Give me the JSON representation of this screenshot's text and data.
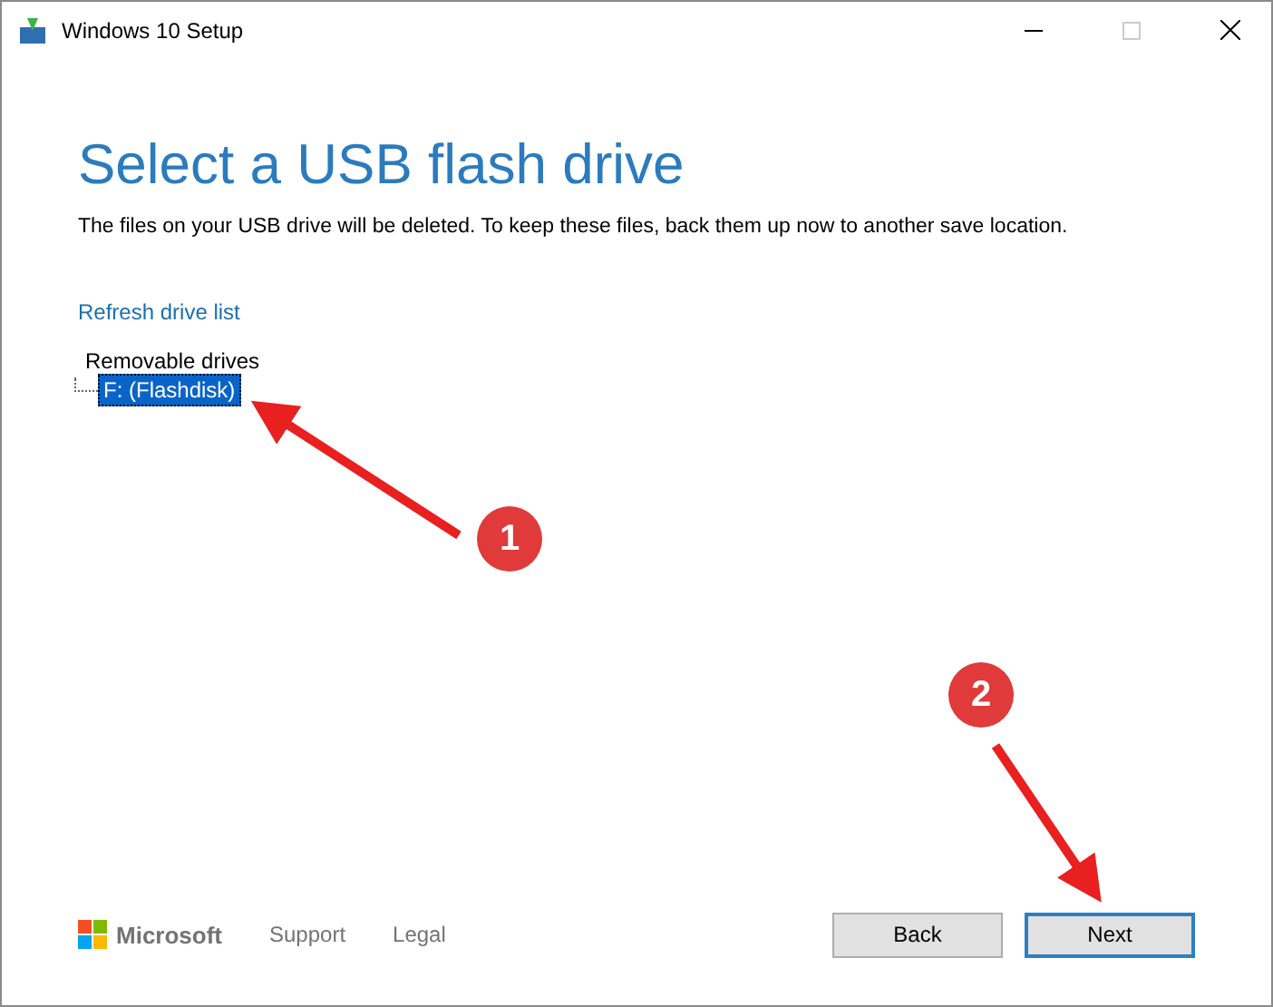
{
  "window": {
    "title": "Windows 10 Setup"
  },
  "heading": "Select a USB flash drive",
  "description": "The files on your USB drive will be deleted. To keep these files, back them up now to another save location.",
  "refresh_link": "Refresh drive list",
  "tree": {
    "label": "Removable drives",
    "children": [
      {
        "label": "F: (Flashdisk)",
        "selected": true
      }
    ]
  },
  "footer": {
    "brand": "Microsoft",
    "links": [
      "Support",
      "Legal"
    ]
  },
  "buttons": [
    {
      "label": "Back",
      "kind": "normal"
    },
    {
      "label": "Next",
      "kind": "default"
    }
  ],
  "annotations": [
    {
      "number": "1"
    },
    {
      "number": "2"
    }
  ]
}
